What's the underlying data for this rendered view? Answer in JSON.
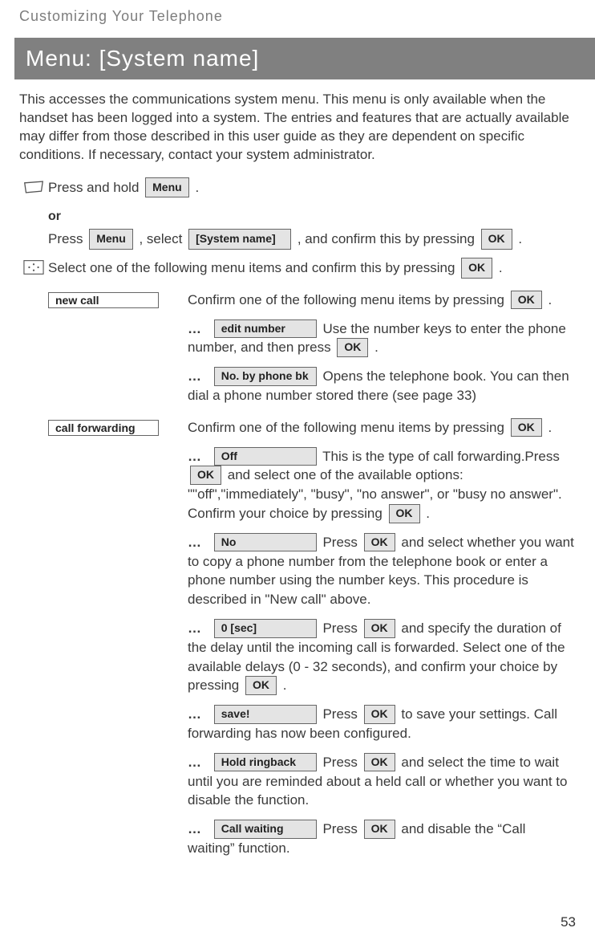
{
  "chapter": "Customizing Your Telephone",
  "title": "Menu: [System name]",
  "intro": "This accesses the communications system menu. This menu is only available when the handset has been logged into a system. The entries and features that are actually available may differ from those described in this user guide as they are dependent on specific conditions. If necessary, contact your system administrator.",
  "buttons": {
    "menu": "Menu",
    "system_name": "[System name]",
    "ok": "OK"
  },
  "steps": {
    "pressHold": "Press and hold ",
    "or": "or",
    "pressSelect_pre": "Press ",
    "pressSelect_mid": " , select ",
    "pressSelect_post": " , and confirm this by pressing ",
    "selectItems": "Select one of the following menu items and confirm this by pressing ",
    "period": " ."
  },
  "left_labels": {
    "new_call": "new call",
    "call_forwarding": "call forwarding"
  },
  "confirm_line": "Confirm one of the following menu items by pressing ",
  "dots": "…",
  "new_call": {
    "edit_number_label": "edit number",
    "edit_number_text": " Use the number keys to enter the phone number, and then press ",
    "phonebk_label": "No. by phone bk",
    "phonebk_text": " Opens the telephone book. You can then dial a phone number stored there (see page 33)"
  },
  "call_forwarding": {
    "off_label": "Off",
    "off_text_pre": " This is the type of call forwarding.Press ",
    "off_text_post": " and select one of the available options: \"\"off\",\"immediately\", \"busy\", \"no answer\", or \"busy no answer\". Confirm your choice by pressing ",
    "no_label": "No",
    "no_text": " and select whether you want to copy a phone number from the telephone book or enter a phone number using the number keys. This procedure is described in \"New call\" above.",
    "delay_label": "0 [sec]",
    "delay_text": " and specify the duration of the delay until the incoming call is forwarded. Select one of the available delays (0 - 32 seconds), and confirm your choice by pressing ",
    "save_label": "save!",
    "save_text": " to save your settings. Call forwarding has now been configured.",
    "hold_label": "Hold ringback",
    "hold_text": " and select the time to wait until you are reminded about a held call or whether you want to disable the function.",
    "wait_label": "Call waiting",
    "wait_text": " and disable the “Call waiting” function.",
    "press_prefix": " Press "
  },
  "page_number": "53"
}
